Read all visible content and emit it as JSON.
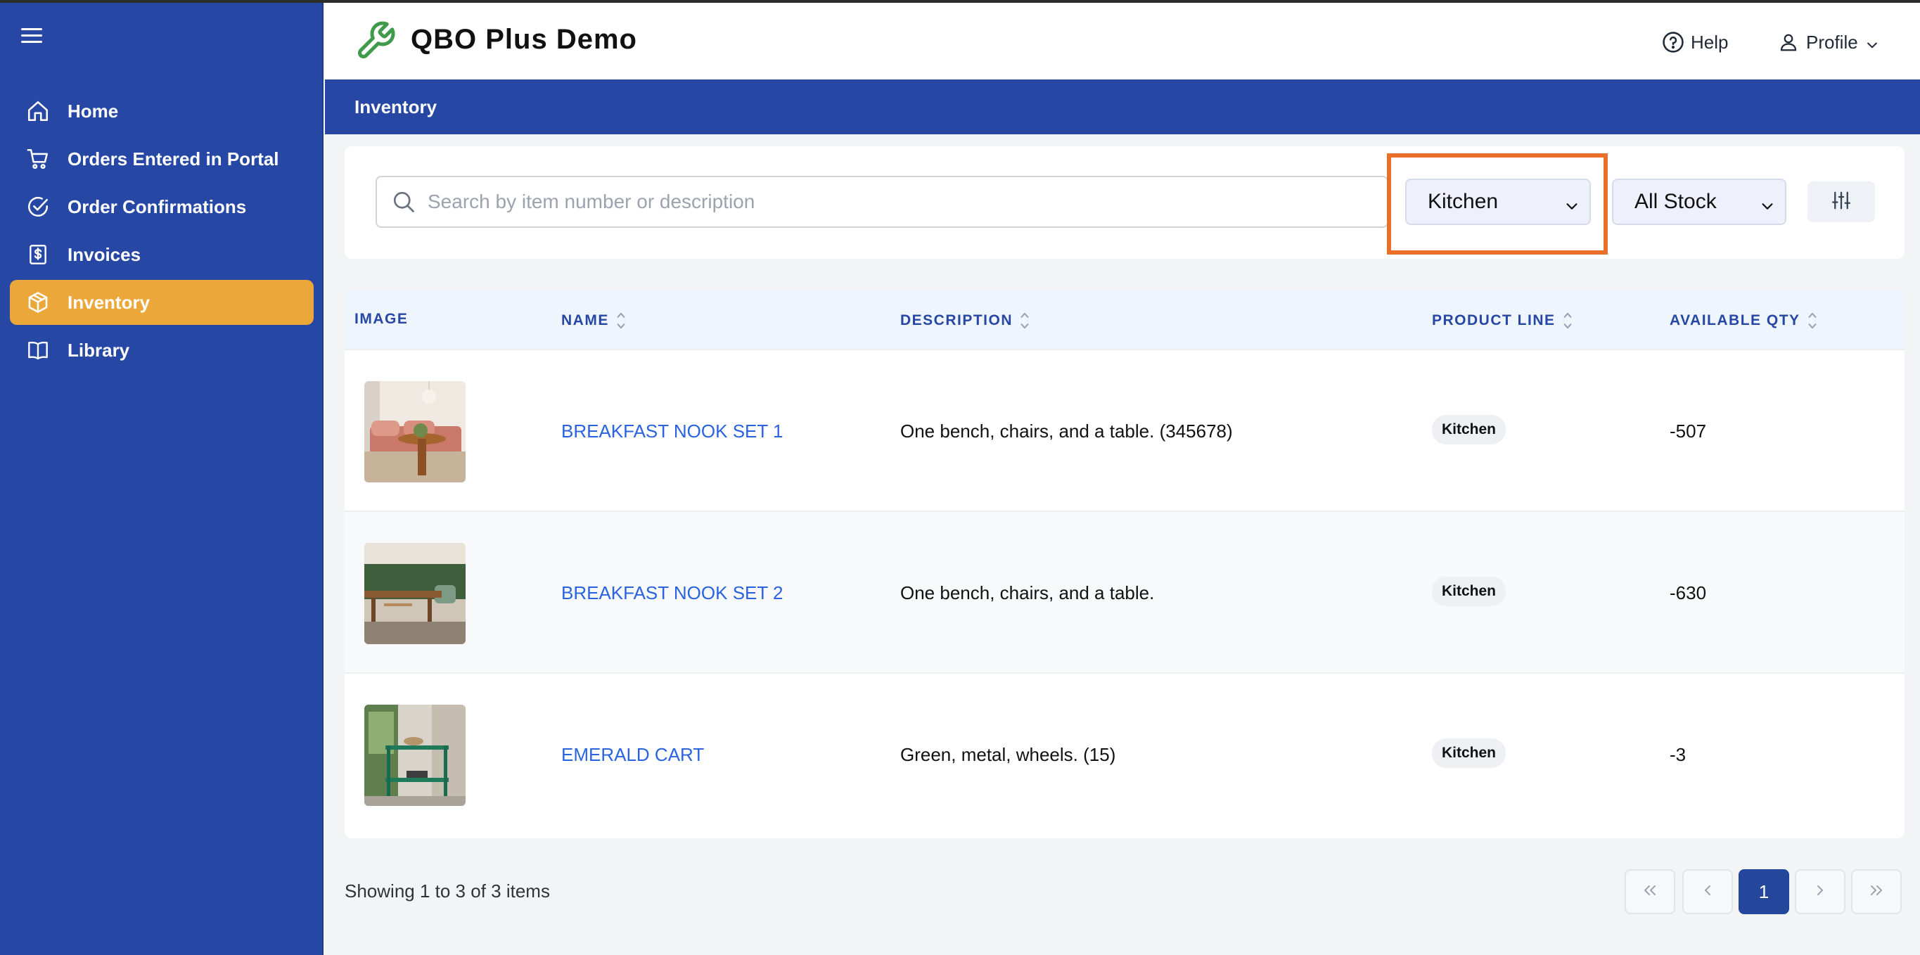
{
  "app": {
    "title": "QBO Plus Demo"
  },
  "header": {
    "help_label": "Help",
    "profile_label": "Profile"
  },
  "sidebar": {
    "items": [
      {
        "label": "Home",
        "icon": "home-icon",
        "active": false
      },
      {
        "label": "Orders Entered in Portal",
        "icon": "cart-icon",
        "active": false
      },
      {
        "label": "Order Confirmations",
        "icon": "check-circle-icon",
        "active": false
      },
      {
        "label": "Invoices",
        "icon": "invoice-dollar-icon",
        "active": false
      },
      {
        "label": "Inventory",
        "icon": "box-icon",
        "active": true
      },
      {
        "label": "Library",
        "icon": "book-icon",
        "active": false
      }
    ]
  },
  "section": {
    "title": "Inventory"
  },
  "filters": {
    "search_placeholder": "Search by item number or description",
    "search_value": "",
    "product_line": "Kitchen",
    "stock": "All Stock"
  },
  "table": {
    "columns": [
      "IMAGE",
      "NAME",
      "DESCRIPTION",
      "PRODUCT LINE",
      "AVAILABLE QTY"
    ],
    "rows": [
      {
        "name": "BREAKFAST NOOK SET 1",
        "description": "One bench, chairs, and a table. (345678)",
        "product_line": "Kitchen",
        "qty": "-507"
      },
      {
        "name": "BREAKFAST NOOK SET 2",
        "description": "One bench, chairs, and a table.",
        "product_line": "Kitchen",
        "qty": "-630"
      },
      {
        "name": "EMERALD CART",
        "description": "Green, metal, wheels. (15)",
        "product_line": "Kitchen",
        "qty": "-3"
      }
    ]
  },
  "footer": {
    "showing": "Showing 1 to 3 of 3 items",
    "current_page": "1"
  },
  "colors": {
    "sidebar": "#2747a4",
    "active": "#eca73b",
    "link": "#2a63e2",
    "highlight": "#ea6f2a"
  }
}
